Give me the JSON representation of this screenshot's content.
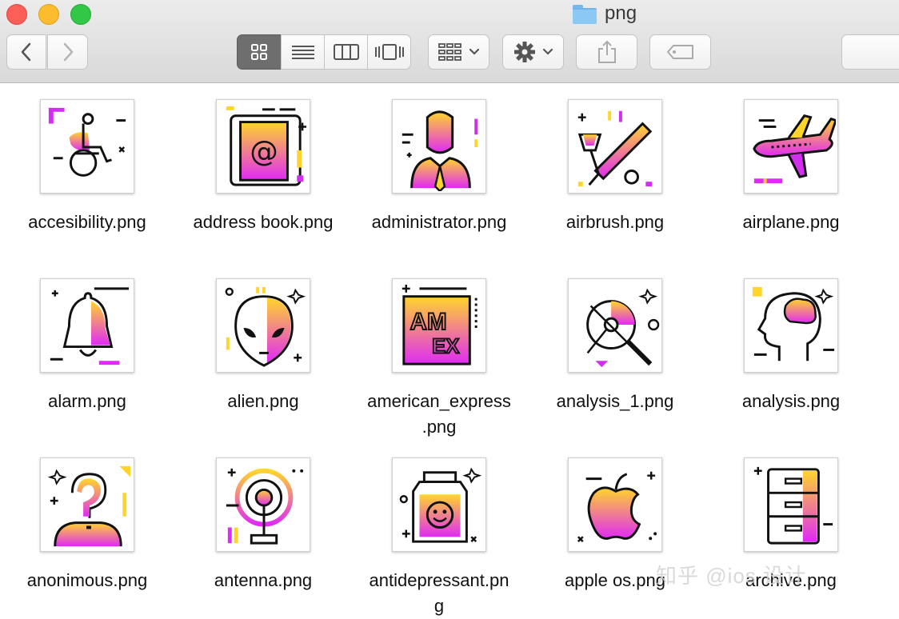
{
  "window": {
    "title": "png",
    "folder_icon": "folder-icon"
  },
  "toolbar": {
    "back_icon": "chevron-left-icon",
    "forward_icon": "chevron-right-icon",
    "view_modes": [
      "icon-view-icon",
      "list-view-icon",
      "column-view-icon",
      "cover-flow-icon"
    ],
    "selected_view": "icon-view-icon",
    "arrange_icon": "arrange-grid-icon",
    "action_icon": "gear-icon",
    "share_icon": "share-icon",
    "tags_icon": "tag-icon"
  },
  "colors": {
    "gradient_start": "#ffd52b",
    "gradient_end": "#e02af5",
    "outline": "#111111",
    "selected_segment": "#6e6e6e"
  },
  "files": [
    {
      "name": "accesibility.png",
      "icon": "wheelchair-icon"
    },
    {
      "name": "address book.png",
      "icon": "address-book-icon"
    },
    {
      "name": "administrator.png",
      "icon": "administrator-icon"
    },
    {
      "name": "airbrush.png",
      "icon": "airbrush-icon"
    },
    {
      "name": "airplane.png",
      "icon": "airplane-icon"
    },
    {
      "name": "alarm.png",
      "icon": "bell-icon"
    },
    {
      "name": "alien.png",
      "icon": "alien-icon"
    },
    {
      "name": "american_express",
      "name2": ".png",
      "icon": "amex-icon"
    },
    {
      "name": "analysis_1.png",
      "icon": "magnifier-analysis-icon"
    },
    {
      "name": "analysis.png",
      "icon": "head-brain-icon"
    },
    {
      "name": "anonimous.png",
      "icon": "anonymous-person-icon"
    },
    {
      "name": "antenna.png",
      "icon": "antenna-icon"
    },
    {
      "name": "antidepressant.pn",
      "name2": "g",
      "icon": "pill-bottle-icon"
    },
    {
      "name": "apple os.png",
      "icon": "apple-icon"
    },
    {
      "name": "archive.png",
      "icon": "archive-cabinet-icon"
    }
  ],
  "watermark": "知乎 @ios 设计"
}
